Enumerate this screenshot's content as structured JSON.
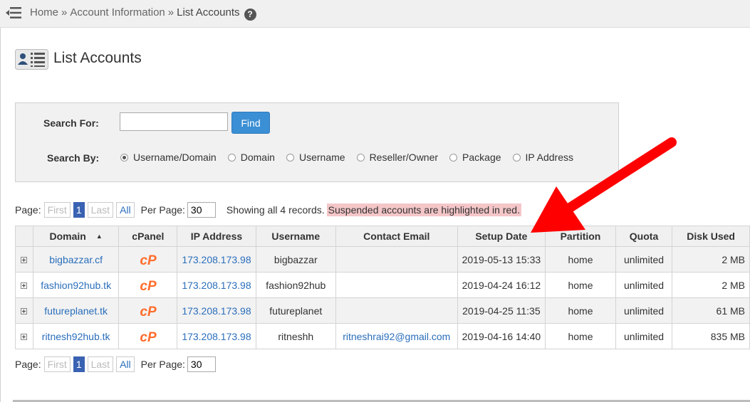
{
  "breadcrumb": {
    "home": "Home",
    "sep": "»",
    "section": "Account Information",
    "current": "List Accounts"
  },
  "page": {
    "title": "List Accounts"
  },
  "search": {
    "label": "Search For:",
    "input_value": "",
    "find_label": "Find",
    "by_label": "Search By:",
    "options": [
      "Username/Domain",
      "Domain",
      "Username",
      "Reseller/Owner",
      "Package",
      "IP Address"
    ],
    "selected": "Username/Domain"
  },
  "pager": {
    "page_label": "Page:",
    "first": "First",
    "current_page": "1",
    "last": "Last",
    "all": "All",
    "per_page_label": "Per Page:",
    "per_page_value": "30",
    "showing": "Showing all 4 records.",
    "suspended_note": "Suspended accounts are highlighted in red."
  },
  "table": {
    "columns": [
      "Domain",
      "cPanel",
      "IP Address",
      "Username",
      "Contact Email",
      "Setup Date",
      "Partition",
      "Quota",
      "Disk Used"
    ],
    "sort_indicator": "▲",
    "rows": [
      {
        "domain": "bigbazzar.cf",
        "ip": "173.208.173.98",
        "username": "bigbazzar",
        "email": "",
        "setup": "2019-05-13 15:33",
        "partition": "home",
        "quota": "unlimited",
        "disk": "2 MB"
      },
      {
        "domain": "fashion92hub.tk",
        "ip": "173.208.173.98",
        "username": "fashion92hub",
        "email": "",
        "setup": "2019-04-24 16:12",
        "partition": "home",
        "quota": "unlimited",
        "disk": "2 MB"
      },
      {
        "domain": "futureplanet.tk",
        "ip": "173.208.173.98",
        "username": "futureplanet",
        "email": "",
        "setup": "2019-04-25 11:35",
        "partition": "home",
        "quota": "unlimited",
        "disk": "61 MB"
      },
      {
        "domain": "ritnesh92hub.tk",
        "ip": "173.208.173.98",
        "username": "ritneshh",
        "email": "ritneshrai92@gmail.com",
        "setup": "2019-04-16 14:40",
        "partition": "home",
        "quota": "unlimited",
        "disk": "835 MB"
      }
    ]
  },
  "colors": {
    "accent": "#3b8fd4",
    "link": "#2a6ebb",
    "cpanel": "#ff6c2c",
    "suspended_bg": "#f4c6c8",
    "arrow": "#ff0000"
  },
  "icons": {
    "menu": "menu-collapse-icon",
    "help": "help-icon",
    "page": "list-accounts-icon",
    "cpanel": "cpanel-logo-icon",
    "expand": "expand-plus-icon"
  }
}
